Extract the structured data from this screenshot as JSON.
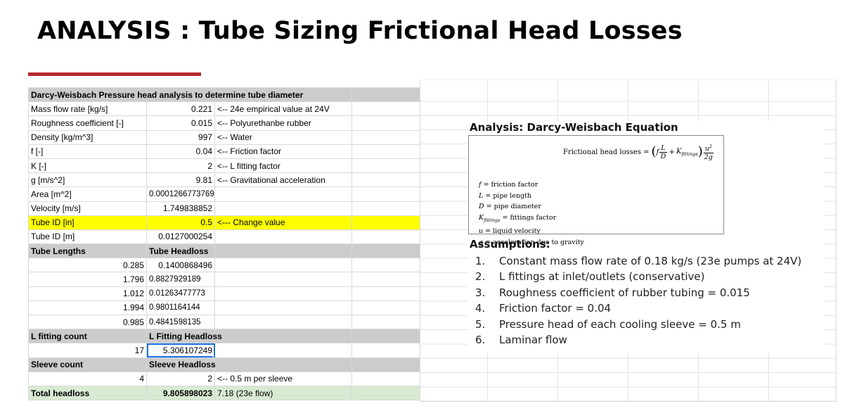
{
  "title": "ANALYSIS : Tube Sizing Frictional Head Losses",
  "colors": {
    "accent": "#b5262f",
    "header": "#cccccc",
    "highlight": "#ffff00",
    "total": "#d9ead3",
    "selection": "#1a73e8"
  },
  "sheet": {
    "header": "Darcy-Weisbach Pressure head analysis to determine tube diameter",
    "params": [
      {
        "label": "Mass flow rate [kg/s]",
        "value": "0.221",
        "note": "<-- 24e empirical value at 24V"
      },
      {
        "label": "Roughness coefficient [-]",
        "value": "0.015",
        "note": "<-- Polyurethanbe rubber"
      },
      {
        "label": "Density [kg/m^3]",
        "value": "997",
        "note": "<-- Water"
      },
      {
        "label": "f [-]",
        "value": "0.04",
        "note": "<-- Friction factor"
      },
      {
        "label": "K [-]",
        "value": "2",
        "note": "<-- L fitting factor"
      },
      {
        "label": "g [m/s^2]",
        "value": "9.81",
        "note": "<-- Gravitational acceleration"
      },
      {
        "label": "Area [m^2]",
        "value": "0.00012667737699"
      },
      {
        "label": "Velocity [m/s]",
        "value": "1.749838852"
      },
      {
        "label": "Tube ID [in]",
        "value": "0.5",
        "note": "<--- Change value"
      },
      {
        "label": "Tube ID [m]",
        "value": "0.0127000254"
      }
    ],
    "lengths_header": {
      "left": "Tube Lengths",
      "right": "Tube Headloss"
    },
    "lengths": [
      {
        "length": "0.285",
        "headloss": "0.1400868496"
      },
      {
        "length": "1.796",
        "headloss": "0.8827929189"
      },
      {
        "length": "1.012",
        "headloss": "0.01263477773"
      },
      {
        "length": "1.994",
        "headloss": "0.9801164144"
      },
      {
        "length": "0.985",
        "headloss": "0.4841598135"
      }
    ],
    "fitting_header": {
      "left": "L fitting count",
      "right": "L Fitting Headloss"
    },
    "fitting": {
      "count": "17",
      "headloss": "5.306107249"
    },
    "sleeve_header": {
      "left": "Sleeve count",
      "right": "Sleeve Headloss"
    },
    "sleeve": {
      "count": "4",
      "headloss": "2",
      "note": "<-- 0.5 m per sleeve"
    },
    "total": {
      "label": "Total headloss",
      "value": "9.805898023",
      "note": "7.18 (23e flow)"
    }
  },
  "analysis": {
    "title": "Analysis: Darcy-Weisbach Equation",
    "equation_label": "Frictional head losses =",
    "definitions": [
      {
        "sym": "f",
        "text": "= friction factor"
      },
      {
        "sym": "L",
        "text": "= pipe length"
      },
      {
        "sym": "D",
        "text": "= pipe diameter"
      },
      {
        "sym": "K",
        "sub": "fittings",
        "text": "= fittings factor"
      },
      {
        "sym": "u",
        "text": "= liquid velocity"
      },
      {
        "sym": "g",
        "text": "= acceleration due to gravity"
      }
    ]
  },
  "assumptions": {
    "title": "Assumptions:",
    "items": [
      {
        "num": "1.",
        "text": "Constant mass flow rate of 0.18 kg/s (23e pumps at 24V)"
      },
      {
        "num": "2.",
        "text": "L fittings at inlet/outlets (conservative)"
      },
      {
        "num": "3.",
        "text": "Roughness coefficient of rubber tubing = 0.015"
      },
      {
        "num": "4.",
        "text": "Friction factor = 0.04"
      },
      {
        "num": "5.",
        "text": "Pressure head of each cooling sleeve = 0.5 m"
      },
      {
        "num": "6.",
        "text": "Laminar flow"
      }
    ]
  }
}
